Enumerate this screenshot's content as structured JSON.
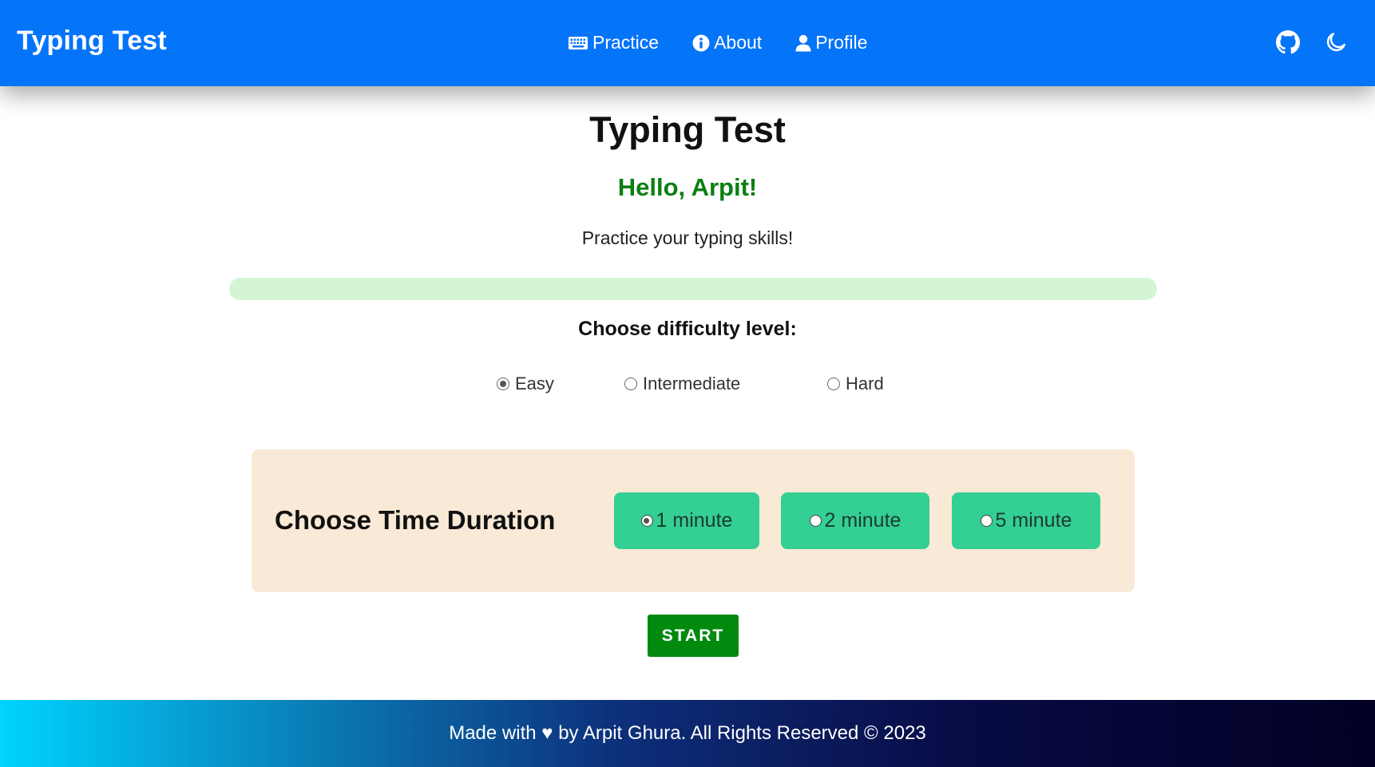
{
  "navbar": {
    "brand": "Typing Test",
    "links": [
      {
        "label": "Practice",
        "icon": "keyboard-icon"
      },
      {
        "label": "About",
        "icon": "info-icon"
      },
      {
        "label": "Profile",
        "icon": "user-icon"
      }
    ],
    "right_icons": [
      "github-icon",
      "moon-icon"
    ],
    "color": "#0474f9"
  },
  "main": {
    "title": "Typing Test",
    "greeting": "Hello, Arpit!",
    "subtitle": "Practice your typing skills!",
    "progress": 0,
    "difficulty": {
      "label": "Choose difficulty level:",
      "options": [
        {
          "label": "Easy",
          "selected": true
        },
        {
          "label": "Intermediate",
          "selected": false
        },
        {
          "label": "Hard",
          "selected": false
        }
      ]
    },
    "duration": {
      "label": "Choose Time Duration",
      "options": [
        {
          "label": "1 minute",
          "selected": true
        },
        {
          "label": "2 minute",
          "selected": false
        },
        {
          "label": "5 minute",
          "selected": false
        }
      ]
    },
    "start_label": "START"
  },
  "footer": {
    "text": "Made with ♥ by Arpit Ghura. All Rights Reserved © 2023"
  },
  "colors": {
    "greeting": "#0b7f12",
    "progress_track": "#d4f5d4",
    "panel_bg": "#f9e9d7",
    "duration_button": "#33cf93",
    "start_button": "#028a0f"
  }
}
